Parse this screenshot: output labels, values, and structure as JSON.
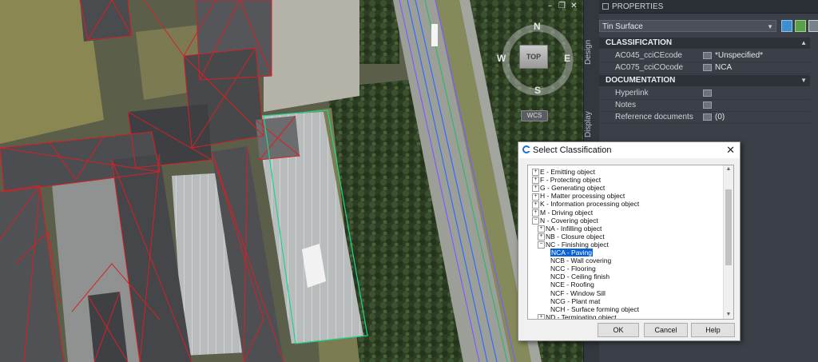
{
  "viewport": {
    "compass": {
      "n": "N",
      "s": "S",
      "e": "E",
      "w": "W",
      "top": "TOP"
    },
    "wcs_label": "WCS",
    "controls": [
      "minimize-icon",
      "restore-icon",
      "close-icon"
    ]
  },
  "side_tabs": [
    "Design",
    "Display"
  ],
  "properties": {
    "title": "PROPERTIES",
    "object_type": "Tin Surface",
    "sections": [
      {
        "name": "CLASSIFICATION",
        "rows": [
          {
            "label": "AC045_cciCEcode",
            "value": "*Unspecified*"
          },
          {
            "label": "AC075_cciCOcode",
            "value": "NCA"
          }
        ]
      },
      {
        "name": "DOCUMENTATION",
        "rows": [
          {
            "label": "Hyperlink",
            "value": ""
          },
          {
            "label": "Notes",
            "value": ""
          },
          {
            "label": "Reference documents",
            "value": "(0)"
          }
        ]
      }
    ]
  },
  "dialog": {
    "title": "Select Classification",
    "nodes": [
      {
        "text": "E - Emitting object",
        "expander": "+",
        "level": 0
      },
      {
        "text": "F - Protecting object",
        "expander": "+",
        "level": 0
      },
      {
        "text": "G - Generating object",
        "expander": "+",
        "level": 0
      },
      {
        "text": "H - Matter processing object",
        "expander": "+",
        "level": 0
      },
      {
        "text": "K - Information processing object",
        "expander": "+",
        "level": 0
      },
      {
        "text": "M - Driving object",
        "expander": "+",
        "level": 0
      },
      {
        "text": "N - Covering object",
        "expander": "−",
        "level": 0
      },
      {
        "text": "NA - Infilling object",
        "expander": "+",
        "level": 1
      },
      {
        "text": "NB - Closure object",
        "expander": "+",
        "level": 1
      },
      {
        "text": "NC - Finishing object",
        "expander": "−",
        "level": 1
      },
      {
        "text": "NCA - Paving",
        "expander": "",
        "level": 2,
        "selected": true
      },
      {
        "text": "NCB - Wall covering",
        "expander": "",
        "level": 2
      },
      {
        "text": "NCC - Flooring",
        "expander": "",
        "level": 2
      },
      {
        "text": "NCD - Ceiling finish",
        "expander": "",
        "level": 2
      },
      {
        "text": "NCE - Roofing",
        "expander": "",
        "level": 2
      },
      {
        "text": "NCF - Window Sill",
        "expander": "",
        "level": 2
      },
      {
        "text": "NCG - Plant mat",
        "expander": "",
        "level": 2
      },
      {
        "text": "NCH - Surface forming object",
        "expander": "",
        "level": 2
      },
      {
        "text": "ND - Terminating object",
        "expander": "+",
        "level": 1
      }
    ],
    "buttons": {
      "ok": "OK",
      "cancel": "Cancel",
      "help": "Help"
    }
  },
  "colors": {
    "selection": "#0a64d8",
    "palette_bg": "#3b4048",
    "section_bg": "#2e3238"
  }
}
